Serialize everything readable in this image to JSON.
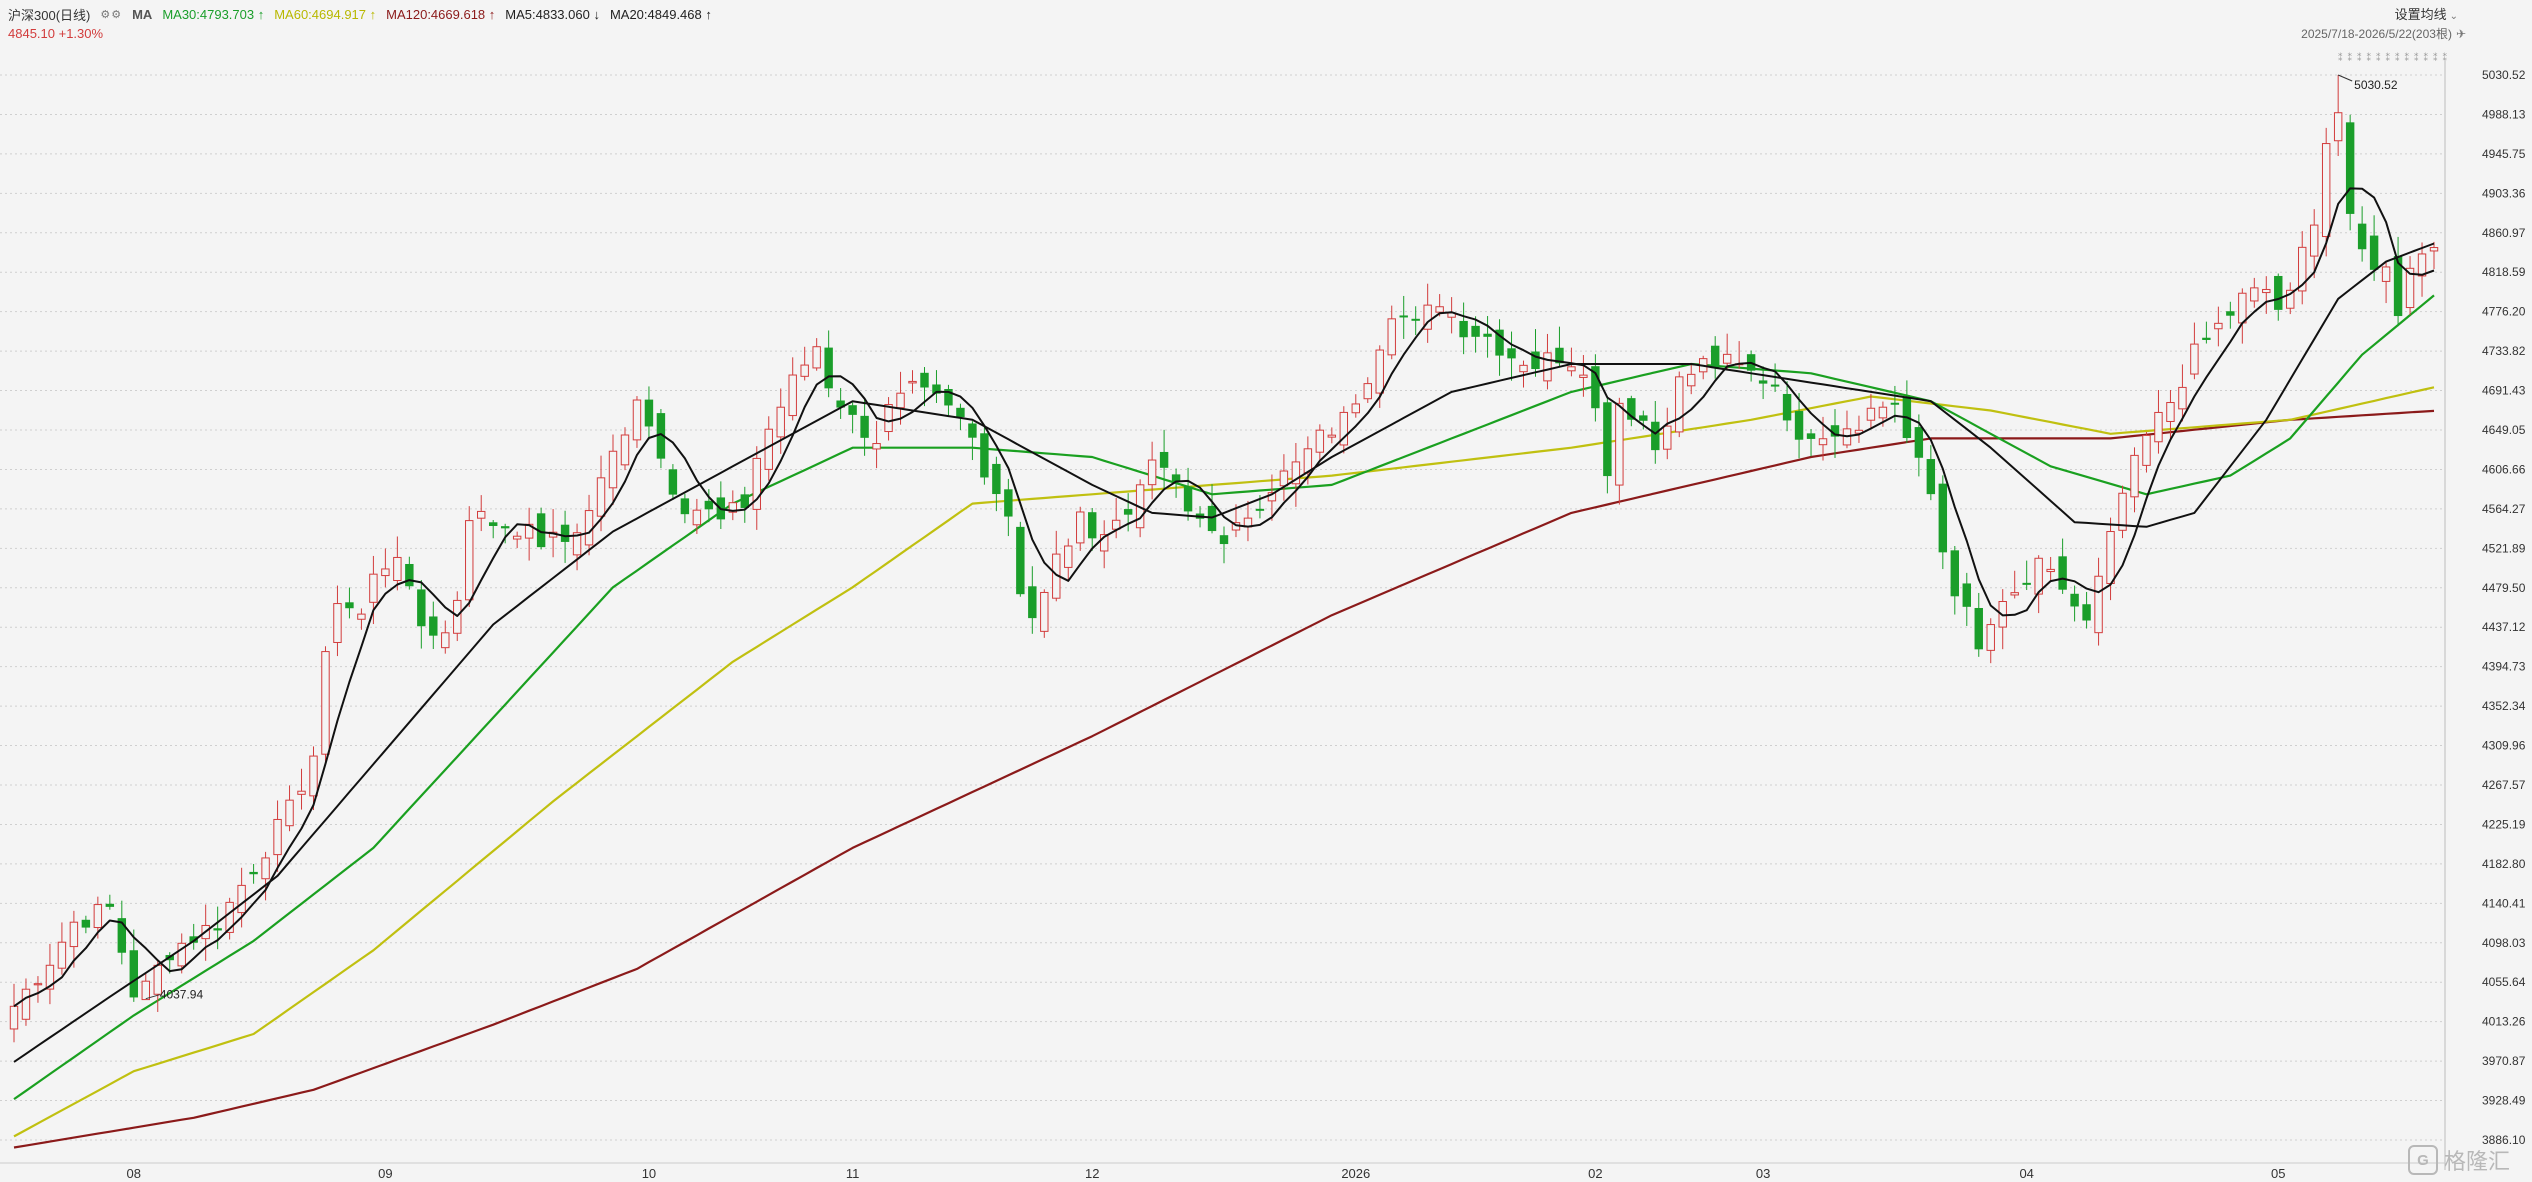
{
  "header": {
    "index_name": "沪深300(日线)",
    "tool_icons": "⚙⚙",
    "ma_label": "MA",
    "ma_items": [
      {
        "text": "MA30:4793.703 ↑",
        "color": "#1a9e2a"
      },
      {
        "text": "MA60:4694.917 ↑",
        "color": "#b8b800"
      },
      {
        "text": "MA120:4669.618 ↑",
        "color": "#8b1a1a"
      },
      {
        "text": "MA5:4833.060 ↓",
        "color": "#222222"
      },
      {
        "text": "MA20:4849.468 ↑",
        "color": "#222222"
      }
    ],
    "last_price": "4845.10 +1.30%",
    "settings_label": "设置均线",
    "date_range": "2025/7/18-2026/5/22(203根)"
  },
  "watermark": "格隆汇",
  "colors": {
    "up": "#d23c3c",
    "down": "#1a9e2a",
    "ma5": "#111111",
    "ma20": "#111111",
    "ma30": "#1aa020",
    "ma60": "#c0c010",
    "ma120": "#8b1a1a",
    "grid": "#cfcfcf"
  },
  "chart_data": {
    "type": "candlestick",
    "y_ticks": [
      "5030.52",
      "4988.13",
      "4945.75",
      "4903.36",
      "4860.97",
      "4818.59",
      "4776.20",
      "4733.82",
      "4691.43",
      "4649.05",
      "4606.66",
      "4564.27",
      "4521.89",
      "4479.50",
      "4437.12",
      "4394.73",
      "4352.34",
      "4309.96",
      "4267.57",
      "4225.19",
      "4182.80",
      "4140.41",
      "4098.03",
      "4055.64",
      "4013.26",
      "3970.87",
      "3928.49",
      "3886.10"
    ],
    "ylim": [
      3886.1,
      5030.52
    ],
    "x_labels": [
      {
        "label": "08",
        "index": 10
      },
      {
        "label": "09",
        "index": 31
      },
      {
        "label": "10",
        "index": 53
      },
      {
        "label": "11",
        "index": 70
      },
      {
        "label": "12",
        "index": 90
      },
      {
        "label": "2026",
        "index": 112
      },
      {
        "label": "02",
        "index": 132
      },
      {
        "label": "03",
        "index": 146
      },
      {
        "label": "04",
        "index": 168
      },
      {
        "label": "05",
        "index": 189
      }
    ],
    "annotations": [
      {
        "text": "5030.52",
        "index": 194,
        "value": 5030.52
      },
      {
        "text": "4037.94",
        "index": 11,
        "value": 4037.94
      }
    ],
    "anchors": [
      [
        0,
        4030
      ],
      [
        3,
        4080
      ],
      [
        5,
        4120
      ],
      [
        8,
        4135
      ],
      [
        9,
        4090
      ],
      [
        10,
        4045
      ],
      [
        11,
        4050
      ],
      [
        13,
        4090
      ],
      [
        17,
        4120
      ],
      [
        19,
        4160
      ],
      [
        21,
        4200
      ],
      [
        23,
        4240
      ],
      [
        25,
        4300
      ],
      [
        26,
        4400
      ],
      [
        27,
        4470
      ],
      [
        29,
        4450
      ],
      [
        30,
        4490
      ],
      [
        32,
        4520
      ],
      [
        33,
        4470
      ],
      [
        34,
        4440
      ],
      [
        36,
        4430
      ],
      [
        37,
        4470
      ],
      [
        38,
        4560
      ],
      [
        40,
        4550
      ],
      [
        42,
        4545
      ],
      [
        44,
        4530
      ],
      [
        46,
        4530
      ],
      [
        48,
        4560
      ],
      [
        49,
        4600
      ],
      [
        51,
        4640
      ],
      [
        52,
        4690
      ],
      [
        53,
        4660
      ],
      [
        54,
        4620
      ],
      [
        55,
        4590
      ],
      [
        56,
        4570
      ],
      [
        58,
        4560
      ],
      [
        59,
        4550
      ],
      [
        61,
        4570
      ],
      [
        62,
        4620
      ],
      [
        63,
        4650
      ],
      [
        65,
        4700
      ],
      [
        67,
        4740
      ],
      [
        68,
        4700
      ],
      [
        70,
        4660
      ],
      [
        72,
        4640
      ],
      [
        73,
        4670
      ],
      [
        75,
        4690
      ],
      [
        77,
        4680
      ],
      [
        79,
        4660
      ],
      [
        80,
        4640
      ],
      [
        81,
        4610
      ],
      [
        83,
        4560
      ],
      [
        84,
        4480
      ],
      [
        85,
        4450
      ],
      [
        86,
        4470
      ],
      [
        87,
        4510
      ],
      [
        89,
        4550
      ],
      [
        91,
        4540
      ],
      [
        93,
        4560
      ],
      [
        94,
        4600
      ],
      [
        96,
        4610
      ],
      [
        98,
        4560
      ],
      [
        100,
        4550
      ],
      [
        101,
        4520
      ],
      [
        103,
        4560
      ],
      [
        105,
        4590
      ],
      [
        107,
        4610
      ],
      [
        109,
        4640
      ],
      [
        111,
        4660
      ],
      [
        113,
        4710
      ],
      [
        115,
        4780
      ],
      [
        117,
        4760
      ],
      [
        119,
        4790
      ],
      [
        121,
        4760
      ],
      [
        123,
        4750
      ],
      [
        125,
        4730
      ],
      [
        127,
        4720
      ],
      [
        129,
        4730
      ],
      [
        131,
        4720
      ],
      [
        132,
        4670
      ],
      [
        133,
        4610
      ],
      [
        134,
        4680
      ],
      [
        136,
        4660
      ],
      [
        137,
        4630
      ],
      [
        139,
        4700
      ],
      [
        141,
        4720
      ],
      [
        143,
        4720
      ],
      [
        145,
        4710
      ],
      [
        147,
        4700
      ],
      [
        148,
        4670
      ],
      [
        149,
        4630
      ],
      [
        150,
        4650
      ],
      [
        152,
        4650
      ],
      [
        154,
        4660
      ],
      [
        155,
        4670
      ],
      [
        157,
        4680
      ],
      [
        158,
        4640
      ],
      [
        160,
        4580
      ],
      [
        161,
        4520
      ],
      [
        162,
        4480
      ],
      [
        163,
        4450
      ],
      [
        164,
        4410
      ],
      [
        165,
        4440
      ],
      [
        167,
        4470
      ],
      [
        169,
        4500
      ],
      [
        171,
        4480
      ],
      [
        172,
        4460
      ],
      [
        173,
        4440
      ],
      [
        175,
        4530
      ],
      [
        176,
        4580
      ],
      [
        178,
        4640
      ],
      [
        180,
        4680
      ],
      [
        182,
        4730
      ],
      [
        184,
        4760
      ],
      [
        186,
        4790
      ],
      [
        188,
        4800
      ],
      [
        189,
        4780
      ],
      [
        190,
        4790
      ],
      [
        191,
        4840
      ],
      [
        192,
        4880
      ],
      [
        193,
        4960
      ],
      [
        194,
        5030
      ],
      [
        195,
        4870
      ],
      [
        196,
        4840
      ],
      [
        197,
        4830
      ],
      [
        198,
        4820
      ],
      [
        199,
        4780
      ],
      [
        200,
        4830
      ],
      [
        202,
        4845.1
      ]
    ],
    "ma120_anchors": [
      [
        0,
        3878
      ],
      [
        15,
        3910
      ],
      [
        25,
        3940
      ],
      [
        40,
        4010
      ],
      [
        52,
        4070
      ],
      [
        70,
        4200
      ],
      [
        90,
        4320
      ],
      [
        110,
        4450
      ],
      [
        130,
        4560
      ],
      [
        150,
        4620
      ],
      [
        160,
        4640
      ],
      [
        175,
        4640
      ],
      [
        190,
        4660
      ],
      [
        202,
        4669.618
      ]
    ],
    "ma60_anchors": [
      [
        0,
        3890
      ],
      [
        10,
        3960
      ],
      [
        20,
        4000
      ],
      [
        30,
        4090
      ],
      [
        45,
        4250
      ],
      [
        60,
        4400
      ],
      [
        70,
        4480
      ],
      [
        80,
        4570
      ],
      [
        90,
        4580
      ],
      [
        110,
        4600
      ],
      [
        130,
        4630
      ],
      [
        145,
        4660
      ],
      [
        155,
        4685
      ],
      [
        165,
        4670
      ],
      [
        175,
        4645
      ],
      [
        190,
        4660
      ],
      [
        202,
        4694.917
      ]
    ],
    "ma30_anchors": [
      [
        0,
        3930
      ],
      [
        10,
        4020
      ],
      [
        20,
        4100
      ],
      [
        30,
        4200
      ],
      [
        40,
        4340
      ],
      [
        50,
        4480
      ],
      [
        60,
        4570
      ],
      [
        70,
        4630
      ],
      [
        80,
        4630
      ],
      [
        90,
        4620
      ],
      [
        100,
        4580
      ],
      [
        110,
        4590
      ],
      [
        120,
        4640
      ],
      [
        130,
        4690
      ],
      [
        140,
        4720
      ],
      [
        150,
        4710
      ],
      [
        160,
        4680
      ],
      [
        170,
        4610
      ],
      [
        178,
        4580
      ],
      [
        185,
        4600
      ],
      [
        190,
        4640
      ],
      [
        196,
        4730
      ],
      [
        202,
        4793.703
      ]
    ],
    "ma20_anchors": [
      [
        0,
        3970
      ],
      [
        8,
        4040
      ],
      [
        15,
        4100
      ],
      [
        22,
        4170
      ],
      [
        30,
        4290
      ],
      [
        40,
        4440
      ],
      [
        50,
        4540
      ],
      [
        60,
        4610
      ],
      [
        70,
        4680
      ],
      [
        80,
        4660
      ],
      [
        90,
        4590
      ],
      [
        95,
        4560
      ],
      [
        100,
        4555
      ],
      [
        105,
        4580
      ],
      [
        110,
        4620
      ],
      [
        120,
        4690
      ],
      [
        130,
        4720
      ],
      [
        140,
        4720
      ],
      [
        150,
        4700
      ],
      [
        160,
        4680
      ],
      [
        165,
        4630
      ],
      [
        172,
        4550
      ],
      [
        178,
        4545
      ],
      [
        182,
        4560
      ],
      [
        188,
        4660
      ],
      [
        194,
        4790
      ],
      [
        198,
        4830
      ],
      [
        202,
        4849.468
      ]
    ]
  }
}
